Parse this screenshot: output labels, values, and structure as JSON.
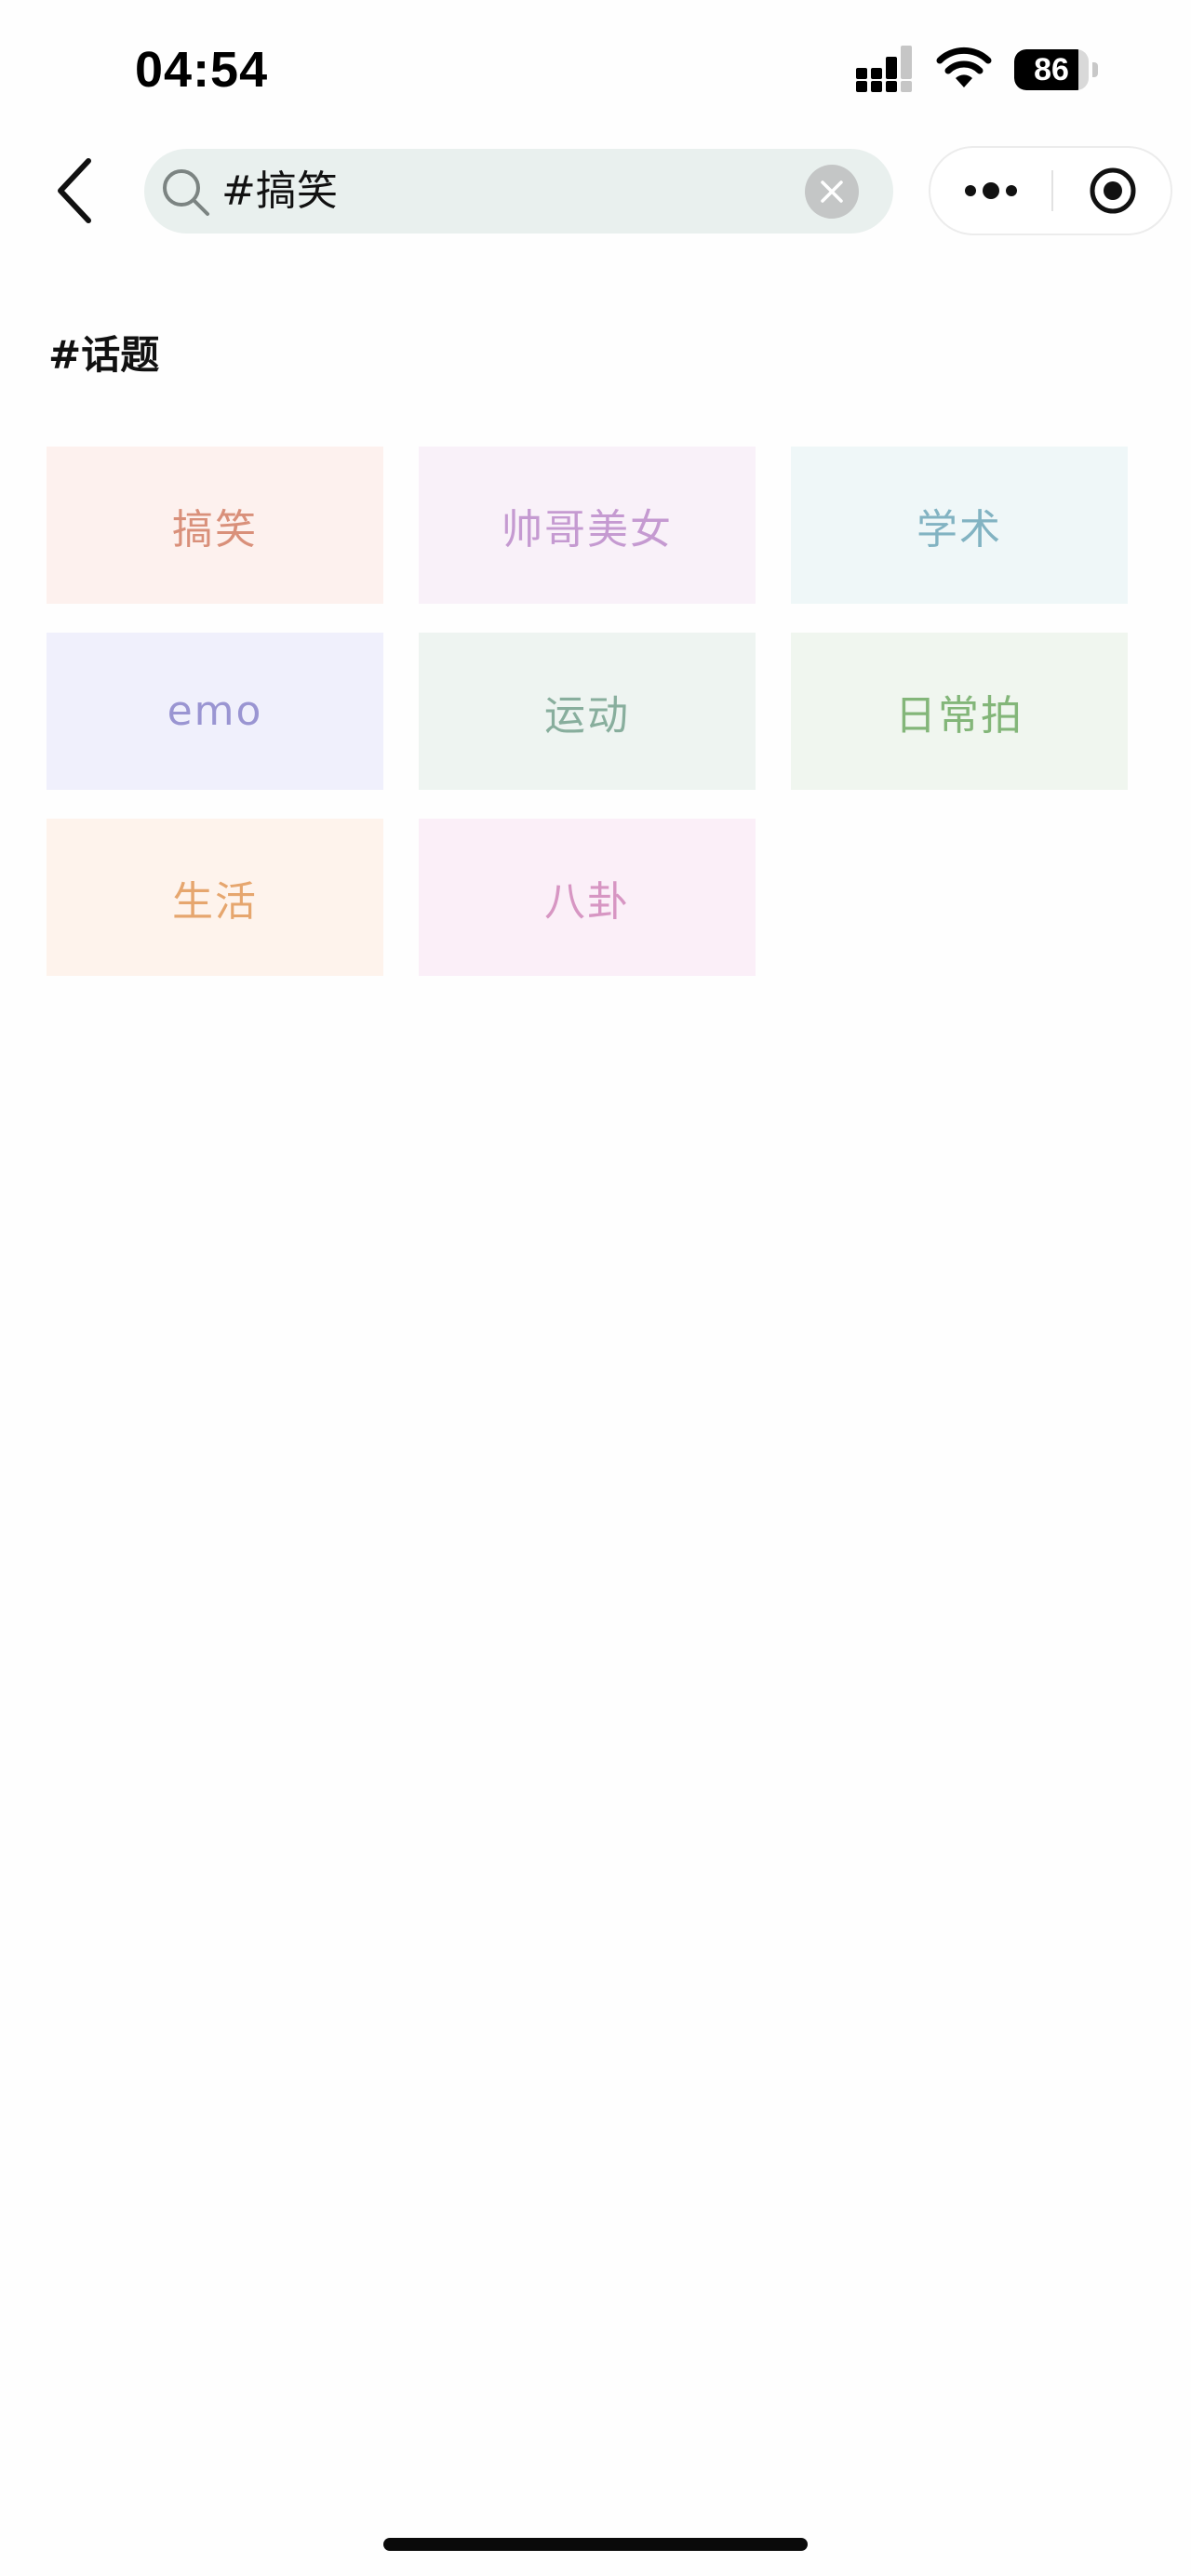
{
  "status_bar": {
    "time": "04:54",
    "battery_level": "86",
    "battery_fraction": 0.86
  },
  "search": {
    "query": "#搞笑"
  },
  "section": {
    "title": "#话题"
  },
  "tags": [
    {
      "label": "搞笑",
      "bg": "#fdf1ee",
      "fg": "#d9907a"
    },
    {
      "label": "帅哥美女",
      "bg": "#f9f1f9",
      "fg": "#c59ad1"
    },
    {
      "label": "学术",
      "bg": "#eff7f8",
      "fg": "#82b3c2"
    },
    {
      "label": "emo",
      "bg": "#f0f0fc",
      "fg": "#9a95d2"
    },
    {
      "label": "运动",
      "bg": "#eef4f1",
      "fg": "#88ae9d"
    },
    {
      "label": "日常拍",
      "bg": "#f0f6ef",
      "fg": "#83b679"
    },
    {
      "label": "生活",
      "bg": "#fef3ec",
      "fg": "#e6a66e"
    },
    {
      "label": "八卦",
      "bg": "#fbeff8",
      "fg": "#d796c3"
    }
  ],
  "icons": {
    "back": "chevron-left-icon",
    "search": "search-icon",
    "clear": "close-circle-icon",
    "more": "more-dots-icon",
    "close_mini": "target-circle-icon"
  }
}
